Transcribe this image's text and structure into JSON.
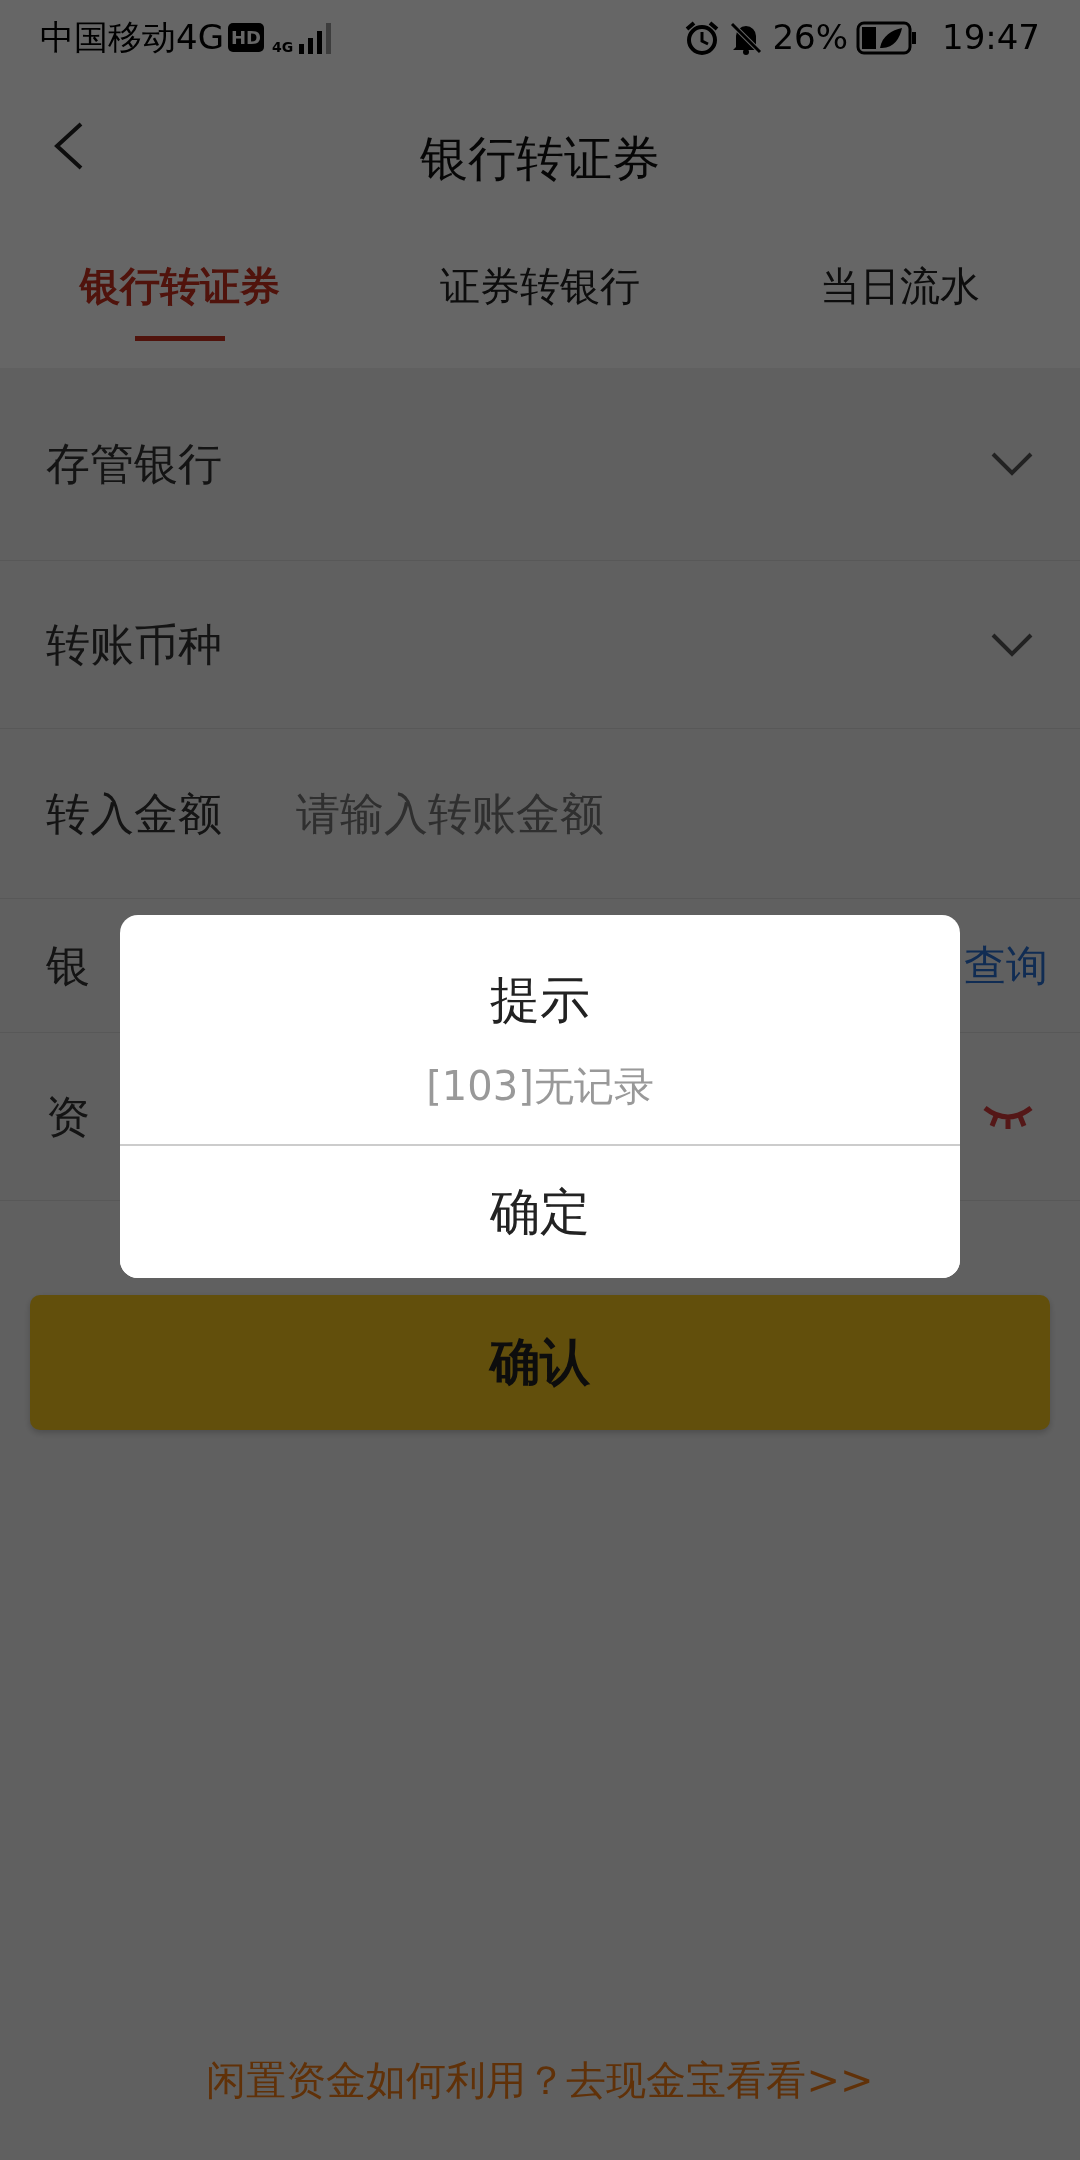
{
  "status_bar": {
    "carrier": "中国移动4G",
    "hd_badge": "HD",
    "network": "4G",
    "battery": "26%",
    "time": "19:47"
  },
  "header": {
    "title": "银行转证券"
  },
  "tabs": [
    {
      "label": "银行转证券",
      "selected": true
    },
    {
      "label": "证券转银行",
      "selected": false
    },
    {
      "label": "当日流水",
      "selected": false
    }
  ],
  "form_rows": [
    {
      "kind": "select",
      "label": "存管银行"
    },
    {
      "kind": "select",
      "label": "转账币种"
    },
    {
      "kind": "input",
      "label": "转入金额",
      "placeholder": "请输入转账金额"
    },
    {
      "kind": "link",
      "label": "银",
      "link": "查询"
    },
    {
      "kind": "eye",
      "label": "资"
    }
  ],
  "confirm_button": "确认",
  "footer_link": "闲置资金如何利用？去现金宝看看>>",
  "dialog": {
    "title": "提示",
    "message": "[103]无记录",
    "button": "确定"
  }
}
